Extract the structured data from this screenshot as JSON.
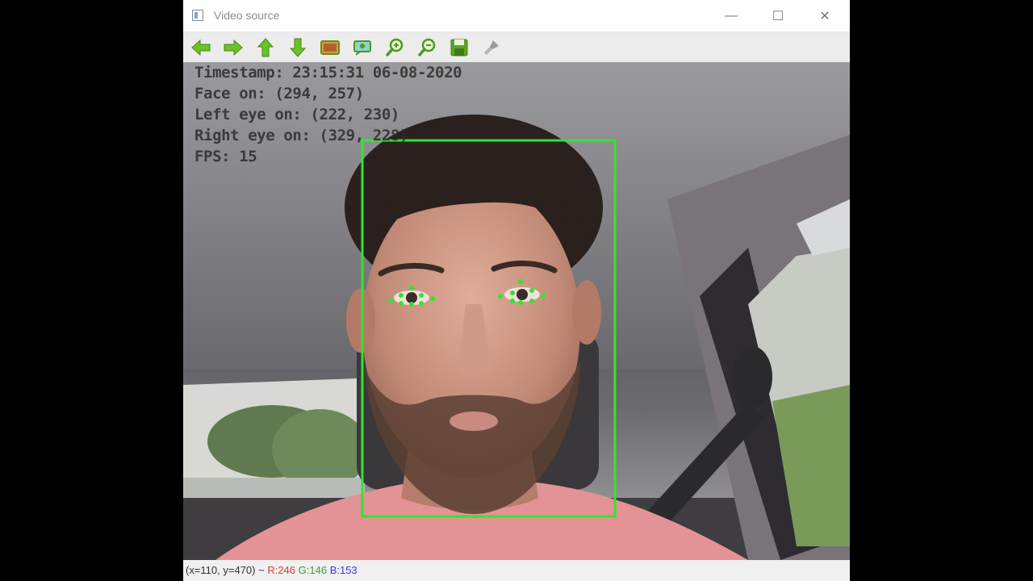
{
  "window": {
    "title": "Video source",
    "controls": {
      "minimize": "—",
      "maximize": "☐",
      "close": "✕"
    }
  },
  "toolbar": {
    "tools": [
      {
        "name": "pan-left-button",
        "icon": "arrow-left-icon"
      },
      {
        "name": "pan-right-button",
        "icon": "arrow-right-icon"
      },
      {
        "name": "pan-up-button",
        "icon": "arrow-up-icon"
      },
      {
        "name": "pan-down-button",
        "icon": "arrow-down-icon"
      },
      {
        "name": "zoom-fit-button",
        "icon": "image-icon"
      },
      {
        "name": "zoom-actual-button",
        "icon": "image-zoom-icon"
      },
      {
        "name": "zoom-in-button",
        "icon": "zoom-in-icon"
      },
      {
        "name": "zoom-out-button",
        "icon": "zoom-out-icon"
      },
      {
        "name": "save-button",
        "icon": "save-icon"
      },
      {
        "name": "properties-button",
        "icon": "brush-icon"
      }
    ]
  },
  "overlay": {
    "timestamp": "Timestamp: 23:15:31 06-08-2020",
    "face": "Face on: (294, 257)",
    "left_eye": "Left eye on: (222, 230)",
    "right_eye": "Right eye on: (329, 228)",
    "fps": "FPS: 15"
  },
  "status": {
    "coords": "(x=110, y=470) ~",
    "r": "R:246",
    "g": "G:146",
    "b": "B:153"
  },
  "colors": {
    "detection": "#2fe62f",
    "toolbar_icon": "#6fbf2a",
    "status_r": "#e03a3a",
    "status_g": "#3aa03a",
    "status_b": "#3a3ae0"
  }
}
